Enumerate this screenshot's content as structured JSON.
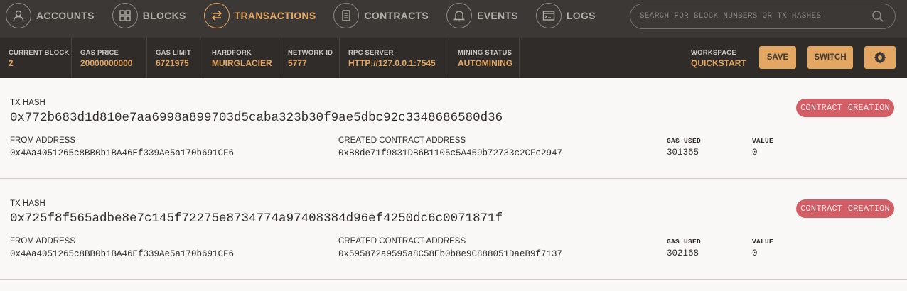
{
  "nav": {
    "items": [
      {
        "label": "ACCOUNTS",
        "icon": "person-icon"
      },
      {
        "label": "BLOCKS",
        "icon": "grid-icon"
      },
      {
        "label": "TRANSACTIONS",
        "icon": "swap-arrows-icon"
      },
      {
        "label": "CONTRACTS",
        "icon": "document-icon"
      },
      {
        "label": "EVENTS",
        "icon": "bell-icon"
      },
      {
        "label": "LOGS",
        "icon": "terminal-icon"
      }
    ],
    "active": "TRANSACTIONS"
  },
  "search": {
    "placeholder": "SEARCH FOR BLOCK NUMBERS OR TX HASHES"
  },
  "status": {
    "current_block": {
      "title": "CURRENT BLOCK",
      "value": "2"
    },
    "gas_price": {
      "title": "GAS PRICE",
      "value": "20000000000"
    },
    "gas_limit": {
      "title": "GAS LIMIT",
      "value": "6721975"
    },
    "hardfork": {
      "title": "HARDFORK",
      "value": "MUIRGLACIER"
    },
    "network_id": {
      "title": "NETWORK ID",
      "value": "5777"
    },
    "rpc_server": {
      "title": "RPC SERVER",
      "value": "HTTP://127.0.0.1:7545"
    },
    "mining_status": {
      "title": "MINING STATUS",
      "value": "AUTOMINING"
    },
    "workspace": {
      "title": "WORKSPACE",
      "value": "QUICKSTART"
    }
  },
  "buttons": {
    "save": "SAVE",
    "switch": "SWITCH"
  },
  "labels": {
    "tx_hash": "TX HASH",
    "from_address": "FROM ADDRESS",
    "created_contract_address": "CREATED CONTRACT ADDRESS",
    "gas_used": "GAS USED",
    "value": "VALUE"
  },
  "transactions": [
    {
      "hash": "0x772b683d1d810e7aa6998a899703d5caba323b30f9ae5dbc92c3348686580d36",
      "type": "CONTRACT CREATION",
      "from": "0x4Aa4051265c8BB0b1BA46Ef339Ae5a170b691CF6",
      "created_contract": "0xB8de71f9831DB6B1105c5A459b72733c2CFc2947",
      "gas_used": "301365",
      "value": "0"
    },
    {
      "hash": "0x725f8f565adbe8e7c145f72275e8734774a97408384d96ef4250dc6c0071871f",
      "type": "CONTRACT CREATION",
      "from": "0x4Aa4051265c8BB0b1BA46Ef339Ae5a170b691CF6",
      "created_contract": "0x595872a9595a8C58Eb0b8e9C888051DaeB9f7137",
      "gas_used": "302168",
      "value": "0"
    }
  ],
  "colors": {
    "accent": "#e4a663",
    "badge": "#d35e66",
    "nav_bg": "#3b3835",
    "status_bg": "#2f2c29"
  }
}
